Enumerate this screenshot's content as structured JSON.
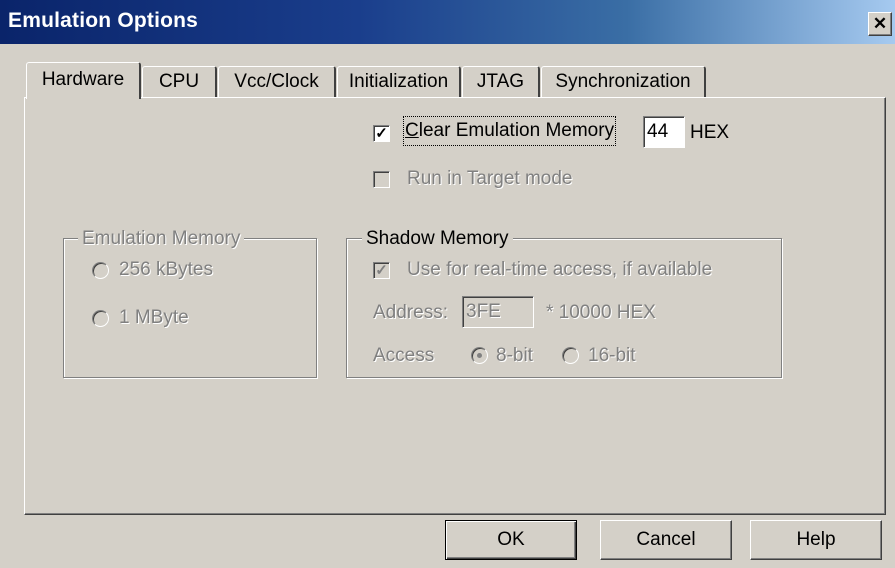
{
  "window": {
    "title": "Emulation Options",
    "close_glyph": "✕"
  },
  "tabs": [
    {
      "label": "Hardware",
      "active": true
    },
    {
      "label": "CPU"
    },
    {
      "label": "Vcc/Clock"
    },
    {
      "label": "Initialization"
    },
    {
      "label": "JTAG"
    },
    {
      "label": "Synchronization"
    }
  ],
  "hardware": {
    "clear_memory": {
      "label": "Clear Emulation Memory",
      "checked": true,
      "value": "44",
      "suffix": "HEX"
    },
    "run_target": {
      "label": "Run in Target mode",
      "checked": false,
      "enabled": false
    },
    "emulation_memory": {
      "legend": "Emulation Memory",
      "options": [
        {
          "label": "256 kBytes"
        },
        {
          "label": "1 MByte"
        }
      ]
    },
    "shadow_memory": {
      "legend": "Shadow Memory",
      "realtime": {
        "label": "Use for real-time access, if available",
        "checked": true
      },
      "address_label": "Address:",
      "address_value": "3FE",
      "address_suffix": "* 10000 HEX",
      "access_label": "Access",
      "access_options": [
        {
          "label": "8-bit",
          "selected": true
        },
        {
          "label": "16-bit",
          "selected": false
        }
      ]
    }
  },
  "buttons": {
    "ok": "OK",
    "cancel": "Cancel",
    "help": "Help"
  },
  "colors": {
    "face": "#d4d0c8",
    "title_start": "#0a246a",
    "title_end": "#a6caf0",
    "disabled_text": "#808080"
  }
}
